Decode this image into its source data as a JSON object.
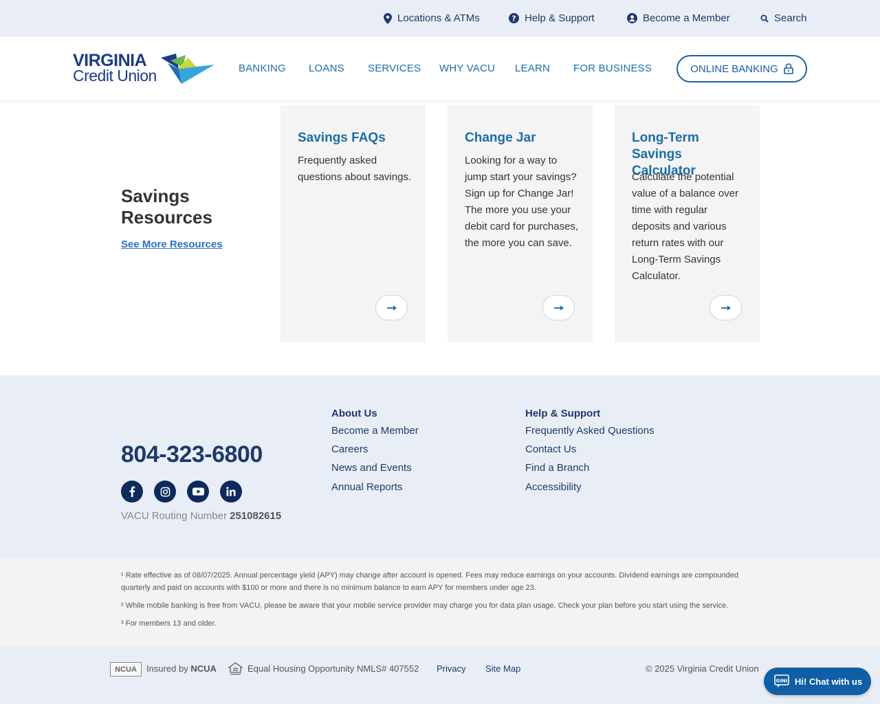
{
  "utility_bar": {
    "locations": "Locations & ATMs",
    "help": "Help & Support",
    "member": "Become a Member",
    "search": "Search"
  },
  "header": {
    "logo_line1": "VIRGINIA",
    "logo_line2": "Credit Union",
    "nav": [
      "BANKING",
      "LOANS",
      "SERVICES",
      "WHY VACU",
      "LEARN",
      "FOR BUSINESS"
    ],
    "online_banking": "ONLINE BANKING"
  },
  "resources": {
    "heading": "Savings Resources",
    "see_more": "See More Resources",
    "cards": [
      {
        "title": "Savings FAQs",
        "desc": "Frequently asked questions about savings."
      },
      {
        "title": "Change Jar",
        "desc": "Looking for a way to jump start your savings? Sign up for Change Jar! The more you use your debit card for purchases, the more you can save."
      },
      {
        "title": "Long-Term Savings Calculator",
        "desc": "Calculate the potential value of a balance over time with regular deposits and various return rates with our Long-Term Savings Calculator."
      }
    ]
  },
  "footer": {
    "phone": "804-323-6800",
    "routing_label": "VACU Routing Number",
    "routing_number": "251082615",
    "about_heading": "About Us",
    "about_links": [
      "Become a Member",
      "Careers",
      "News and Events",
      "Annual Reports"
    ],
    "help_heading": "Help & Support",
    "help_links": [
      "Frequently Asked Questions",
      "Contact Us",
      "Find a Branch",
      "Accessibility"
    ]
  },
  "disclosures": [
    "¹ Rate effective as of 08/07/2025. Annual percentage yield (APY) may change after account is opened. Fees may reduce earnings on your accounts. Dividend earnings are compounded quarterly and paid on accounts with $100 or more and there is no minimum balance to earn APY for members under age 23.",
    "² While mobile banking is free from VACU, please be aware that your mobile service provider may charge you for data plan usage. Check your plan before you start using the service.",
    "³ For members 13 and older."
  ],
  "bottom": {
    "ncua_badge": "NCUA",
    "insured_by": "Insured by",
    "ncua": "NCUA",
    "equal_housing": "Equal Housing Opportunity NMLS# 407552",
    "privacy": "Privacy",
    "sitemap": "Site Map",
    "copyright": "© 2025 Virginia Credit Union"
  },
  "chat": {
    "label": "Hi! Chat with us",
    "badge": "GINI"
  },
  "colors": {
    "brand_blue": "#1d3a6b",
    "link_blue": "#1a6ea8",
    "footer_bg": "#e9eef6"
  }
}
